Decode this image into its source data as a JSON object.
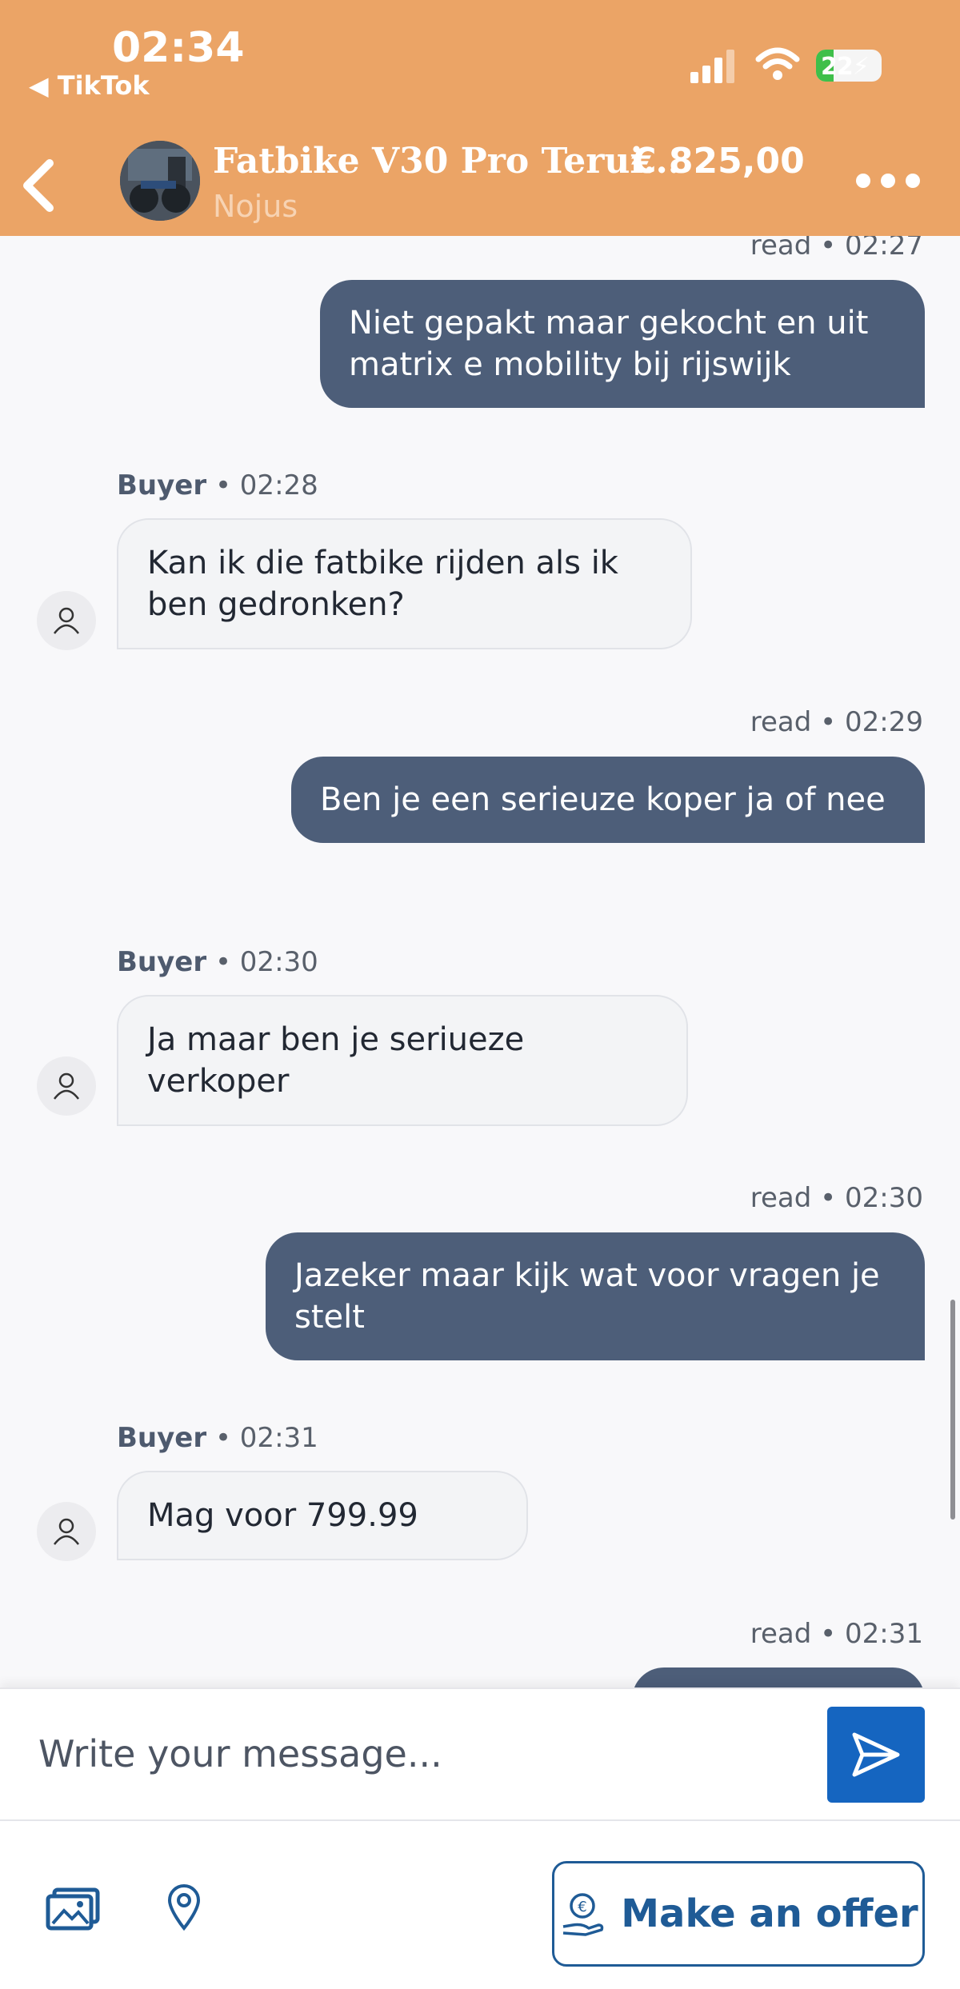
{
  "status_bar": {
    "time": "02:34",
    "back_app": "◀ TikTok",
    "battery": "22⚡"
  },
  "header": {
    "title": "Fatbike V30 Pro Terui...",
    "price": "€ 825,00",
    "seller": "Nojus"
  },
  "messages": [
    {
      "meta": "read • 02:27",
      "text": "Niet gepakt maar gekocht en uit matrix e mobility bij rijswijk"
    },
    {
      "sender": "Buyer",
      "time": "• 02:28",
      "text": "Kan ik die fatbike rijden als ik ben gedronken?"
    },
    {
      "meta": "read • 02:29",
      "text": "Ben je een serieuze koper ja of nee"
    },
    {
      "sender": "Buyer",
      "time": "• 02:30",
      "text": "Ja maar ben je seriueze verkoper"
    },
    {
      "meta": "read • 02:30",
      "text": "Jazeker maar kijk wat voor vragen je stelt"
    },
    {
      "sender": "Buyer",
      "time": "• 02:31",
      "text": "Mag voor 799.99"
    },
    {
      "meta": "read • 02:31",
      "text": ""
    }
  ],
  "composer": {
    "placeholder": "Write your message..."
  },
  "actions": {
    "offer_label": "Make an offer"
  },
  "colors": {
    "header": "#eba466",
    "outgoing": "#4d5e79",
    "incoming": "#f3f4f6",
    "primary": "#1565c0"
  }
}
